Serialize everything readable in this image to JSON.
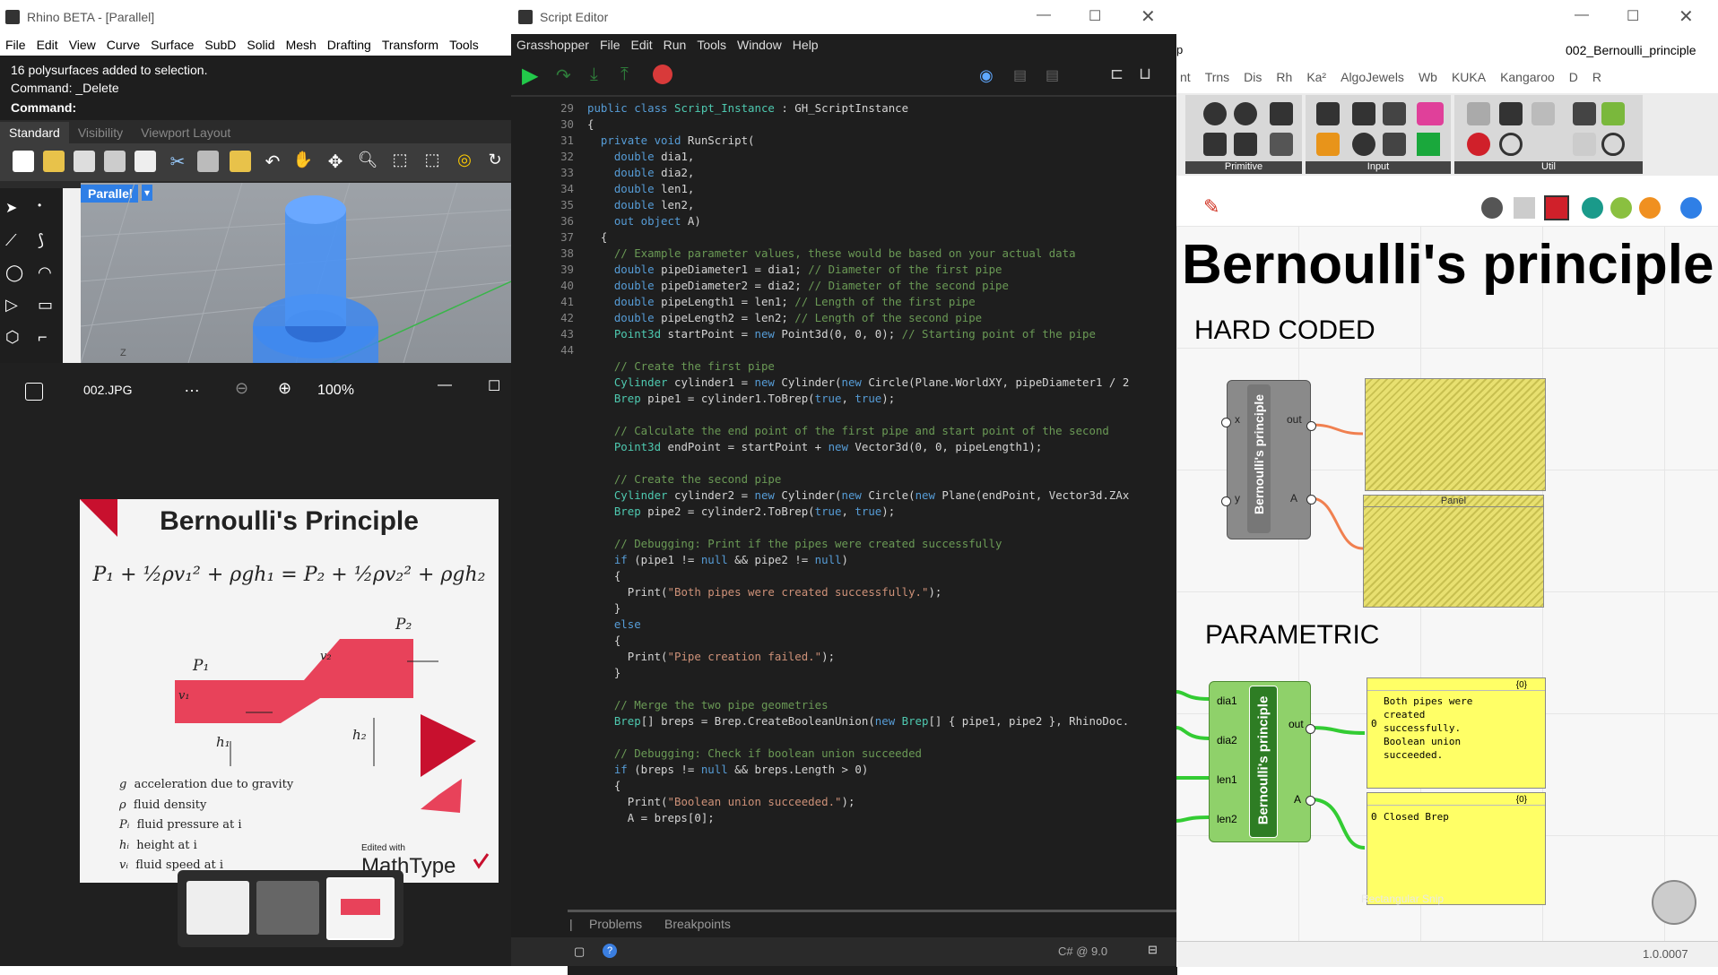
{
  "rhino": {
    "title": "Rhino BETA - [Parallel]",
    "menu": [
      "File",
      "Edit",
      "View",
      "Curve",
      "Surface",
      "SubD",
      "Solid",
      "Mesh",
      "Drafting",
      "Transform",
      "Tools"
    ],
    "cmd_lines": [
      "16 polysurfaces added to selection.",
      "Command: _Delete"
    ],
    "cmd_prompt": "Command:",
    "tabs": [
      "Standard",
      "Visibility",
      "Viewport Layout"
    ],
    "viewport_label": "Parallel",
    "axis_label": "Z"
  },
  "viewer": {
    "filename": "002.JPG",
    "more": "…",
    "zoom": "100%",
    "image": {
      "title": "Bernoulli's Principle",
      "equation": "P₁ + ½ρv₁² + ρgh₁ = P₂ + ½ρv₂² + ρgh₂",
      "p1": "P₁",
      "p2": "P₂",
      "v1": "v₁",
      "v2": "v₂",
      "h1": "h₁",
      "h2": "h₂",
      "legend": [
        {
          "sym": "g",
          "text": "acceleration due to gravity"
        },
        {
          "sym": "ρ",
          "text": "fluid density"
        },
        {
          "sym": "Pᵢ",
          "text": "fluid pressure at i"
        },
        {
          "sym": "hᵢ",
          "text": "height at i"
        },
        {
          "sym": "vᵢ",
          "text": "fluid speed at i"
        }
      ],
      "edited_with": "Edited with",
      "brand": "MathType"
    }
  },
  "editor": {
    "title": "Script Editor",
    "menu": [
      "Grasshopper",
      "File",
      "Edit",
      "Run",
      "Tools",
      "Window",
      "Help"
    ],
    "bottom_tabs": [
      "Problems",
      "Breakpoints"
    ],
    "status": "C# @ 9.0",
    "code": [
      {
        "n": "29",
        "t": [
          [
            "public class ",
            "kw"
          ],
          [
            "Script_Instance",
            "tp"
          ],
          [
            " : GH_ScriptInstance",
            ""
          ]
        ]
      },
      {
        "n": "30",
        "t": [
          [
            "{",
            ""
          ]
        ]
      },
      {
        "n": "31",
        "t": [
          [
            "  private void ",
            "kw"
          ],
          [
            "RunScript(",
            ""
          ]
        ]
      },
      {
        "n": "32",
        "t": [
          [
            "    double ",
            "kw"
          ],
          [
            "dia1,",
            ""
          ]
        ]
      },
      {
        "n": "33",
        "t": [
          [
            "    double ",
            "kw"
          ],
          [
            "dia2,",
            ""
          ]
        ]
      },
      {
        "n": "34",
        "t": [
          [
            "    double ",
            "kw"
          ],
          [
            "len1,",
            ""
          ]
        ]
      },
      {
        "n": "35",
        "t": [
          [
            "    double ",
            "kw"
          ],
          [
            "len2,",
            ""
          ]
        ]
      },
      {
        "n": "36",
        "t": [
          [
            "    out object ",
            "kw"
          ],
          [
            "A)",
            ""
          ]
        ]
      },
      {
        "n": "37",
        "t": [
          [
            "  {",
            ""
          ]
        ]
      },
      {
        "n": "38",
        "t": [
          [
            "    // Example parameter values, these would be based on your actual data",
            "cm"
          ]
        ]
      },
      {
        "n": "39",
        "t": [
          [
            "    double ",
            "kw"
          ],
          [
            "pipeDiameter1 = dia1; ",
            ""
          ],
          [
            "// Diameter of the first pipe",
            "cm"
          ]
        ]
      },
      {
        "n": "40",
        "t": [
          [
            "    double ",
            "kw"
          ],
          [
            "pipeDiameter2 = dia2; ",
            ""
          ],
          [
            "// Diameter of the second pipe",
            "cm"
          ]
        ]
      },
      {
        "n": "41",
        "t": [
          [
            "    double ",
            "kw"
          ],
          [
            "pipeLength1 = len1; ",
            ""
          ],
          [
            "// Length of the first pipe",
            "cm"
          ]
        ]
      },
      {
        "n": "42",
        "t": [
          [
            "    double ",
            "kw"
          ],
          [
            "pipeLength2 = len2; ",
            ""
          ],
          [
            "// Length of the second pipe",
            "cm"
          ]
        ]
      },
      {
        "n": "43",
        "t": [
          [
            "    Point3d ",
            "tp"
          ],
          [
            "startPoint = ",
            ""
          ],
          [
            "new ",
            "kw"
          ],
          [
            "Point3d(0, 0, 0); ",
            ""
          ],
          [
            "// Starting point of the pipe",
            "cm"
          ]
        ]
      },
      {
        "n": "44",
        "t": [
          [
            "",
            ""
          ]
        ]
      },
      {
        "n": "",
        "t": [
          [
            "    // Create the first pipe",
            "cm"
          ]
        ]
      },
      {
        "n": "",
        "t": [
          [
            "    Cylinder ",
            "tp"
          ],
          [
            "cylinder1 = ",
            ""
          ],
          [
            "new ",
            "kw"
          ],
          [
            "Cylinder(",
            ""
          ],
          [
            "new ",
            "kw"
          ],
          [
            "Circle(Plane.WorldXY, pipeDiameter1 / 2",
            ""
          ]
        ]
      },
      {
        "n": "",
        "t": [
          [
            "    Brep ",
            "tp"
          ],
          [
            "pipe1 = cylinder1.ToBrep(",
            ""
          ],
          [
            "true",
            "kw"
          ],
          [
            ", ",
            ""
          ],
          [
            "true",
            "kw"
          ],
          [
            ");",
            ""
          ]
        ]
      },
      {
        "n": "",
        "t": [
          [
            "",
            ""
          ]
        ]
      },
      {
        "n": "",
        "t": [
          [
            "    // Calculate the end point of the first pipe and start point of the second",
            "cm"
          ]
        ]
      },
      {
        "n": "",
        "t": [
          [
            "    Point3d ",
            "tp"
          ],
          [
            "endPoint = startPoint + ",
            ""
          ],
          [
            "new ",
            "kw"
          ],
          [
            "Vector3d(0, 0, pipeLength1);",
            ""
          ]
        ]
      },
      {
        "n": "",
        "t": [
          [
            "",
            ""
          ]
        ]
      },
      {
        "n": "",
        "t": [
          [
            "    // Create the second pipe",
            "cm"
          ]
        ]
      },
      {
        "n": "",
        "t": [
          [
            "    Cylinder ",
            "tp"
          ],
          [
            "cylinder2 = ",
            ""
          ],
          [
            "new ",
            "kw"
          ],
          [
            "Cylinder(",
            ""
          ],
          [
            "new ",
            "kw"
          ],
          [
            "Circle(",
            ""
          ],
          [
            "new ",
            "kw"
          ],
          [
            "Plane(endPoint, Vector3d.ZAx",
            ""
          ]
        ]
      },
      {
        "n": "",
        "t": [
          [
            "    Brep ",
            "tp"
          ],
          [
            "pipe2 = cylinder2.ToBrep(",
            ""
          ],
          [
            "true",
            "kw"
          ],
          [
            ", ",
            ""
          ],
          [
            "true",
            "kw"
          ],
          [
            ");",
            ""
          ]
        ]
      },
      {
        "n": "",
        "t": [
          [
            "",
            ""
          ]
        ]
      },
      {
        "n": "",
        "t": [
          [
            "    // Debugging: Print if the pipes were created successfully",
            "cm"
          ]
        ]
      },
      {
        "n": "",
        "t": [
          [
            "    if ",
            "kw"
          ],
          [
            "(pipe1 != ",
            ""
          ],
          [
            "null ",
            "kw"
          ],
          [
            "&& pipe2 != ",
            ""
          ],
          [
            "null",
            "kw"
          ],
          [
            ")",
            ""
          ]
        ]
      },
      {
        "n": "",
        "t": [
          [
            "    {",
            ""
          ]
        ]
      },
      {
        "n": "",
        "t": [
          [
            "      Print(",
            ""
          ],
          [
            "\"Both pipes were created successfully.\"",
            "st"
          ],
          [
            ");",
            ""
          ]
        ]
      },
      {
        "n": "",
        "t": [
          [
            "    }",
            ""
          ]
        ]
      },
      {
        "n": "",
        "t": [
          [
            "    else",
            "kw"
          ]
        ]
      },
      {
        "n": "",
        "t": [
          [
            "    {",
            ""
          ]
        ]
      },
      {
        "n": "",
        "t": [
          [
            "      Print(",
            ""
          ],
          [
            "\"Pipe creation failed.\"",
            "st"
          ],
          [
            ");",
            ""
          ]
        ]
      },
      {
        "n": "",
        "t": [
          [
            "    }",
            ""
          ]
        ]
      },
      {
        "n": "",
        "t": [
          [
            "",
            ""
          ]
        ]
      },
      {
        "n": "",
        "t": [
          [
            "    // Merge the two pipe geometries",
            "cm"
          ]
        ]
      },
      {
        "n": "",
        "t": [
          [
            "    Brep",
            "tp"
          ],
          [
            "[] breps = Brep.CreateBooleanUnion(",
            ""
          ],
          [
            "new ",
            "kw"
          ],
          [
            "Brep",
            "tp"
          ],
          [
            "[] { pipe1, pipe2 }, RhinoDoc.",
            ""
          ]
        ]
      },
      {
        "n": "",
        "t": [
          [
            "",
            ""
          ]
        ]
      },
      {
        "n": "",
        "t": [
          [
            "    // Debugging: Check if boolean union succeeded",
            "cm"
          ]
        ]
      },
      {
        "n": "",
        "t": [
          [
            "    if ",
            "kw"
          ],
          [
            "(breps != ",
            ""
          ],
          [
            "null ",
            "kw"
          ],
          [
            "&& breps.Length > 0)",
            ""
          ]
        ]
      },
      {
        "n": "",
        "t": [
          [
            "    {",
            ""
          ]
        ]
      },
      {
        "n": "",
        "t": [
          [
            "      Print(",
            ""
          ],
          [
            "\"Boolean union succeeded.\"",
            "st"
          ],
          [
            ");",
            ""
          ]
        ]
      },
      {
        "n": "",
        "t": [
          [
            "      A = breps[0];",
            ""
          ]
        ]
      }
    ]
  },
  "grasshopper": {
    "filename": "002_Bernoulli_principle",
    "tabs": [
      "nt",
      "Trns",
      "Dis",
      "Rh",
      "Ka²",
      "AlgoJewels",
      "Wb",
      "KUKA",
      "Kangaroo",
      "D",
      "R"
    ],
    "groups": [
      "Primitive",
      "Input",
      "Util"
    ],
    "title": "Bernoulli's principle",
    "section_hard": "HARD CODED",
    "section_param": "PARAMETRIC",
    "comp_label": "Bernoulli's principle",
    "hc_inputs": [
      "x",
      "y"
    ],
    "outputs": [
      "out",
      "A"
    ],
    "param_inputs": [
      "dia1",
      "dia2",
      "len1",
      "len2"
    ],
    "panel_title": "Panel",
    "panel1": {
      "path": "{0}",
      "idx": "0",
      "text": "Both pipes were created successfully. Boolean union succeeded."
    },
    "panel2": {
      "path": "{0}",
      "idx": "0",
      "text": "Closed Brep"
    },
    "ghost_text": "Rectangular Snip",
    "version": "1.0.0007"
  },
  "colors": {
    "gh_green": "#8fd16a",
    "wire_orange": "#f08050",
    "wire_green": "#33cc33",
    "panel": "#ffff66",
    "rhino_blue": "#2f7fe6",
    "bern_red": "#e8425a"
  }
}
